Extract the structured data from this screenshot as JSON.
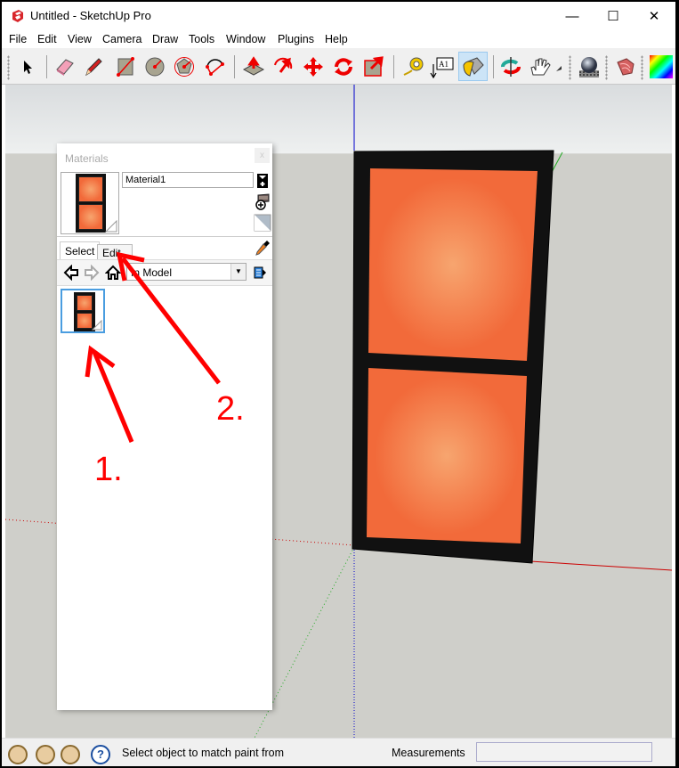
{
  "window": {
    "title": "Untitled - SketchUp Pro",
    "controls": {
      "minimize": "—",
      "maximize": "☐",
      "close": "✕"
    }
  },
  "menu": [
    "File",
    "Edit",
    "View",
    "Camera",
    "Draw",
    "Tools",
    "Window",
    "Plugins",
    "Help"
  ],
  "toolbar": {
    "tools": [
      {
        "name": "select-tool",
        "icon": "arrow-pointer"
      },
      {
        "name": "eraser-tool",
        "icon": "eraser"
      },
      {
        "name": "line-tool",
        "icon": "pencil"
      },
      {
        "name": "rectangle-tool",
        "icon": "rectangle"
      },
      {
        "name": "circle-tool",
        "icon": "circle"
      },
      {
        "name": "polygon-tool",
        "icon": "polygon"
      },
      {
        "name": "arc-tool",
        "icon": "arc"
      },
      {
        "name": "push-pull-tool",
        "icon": "push-pull"
      },
      {
        "name": "follow-me-tool",
        "icon": "follow-me"
      },
      {
        "name": "move-tool",
        "icon": "move"
      },
      {
        "name": "rotate-tool",
        "icon": "rotate"
      },
      {
        "name": "scale-tool",
        "icon": "scale"
      },
      {
        "name": "tape-measure-tool",
        "icon": "tape-measure"
      },
      {
        "name": "text-tool",
        "icon": "text",
        "label": "A1"
      },
      {
        "name": "paint-bucket-tool",
        "icon": "paint-bucket",
        "active": true
      },
      {
        "name": "orbit-tool",
        "icon": "orbit"
      },
      {
        "name": "pan-tool",
        "icon": "hand"
      },
      {
        "name": "render-tool",
        "icon": "sphere"
      },
      {
        "name": "sandbox-tool",
        "icon": "terrain"
      },
      {
        "name": "color-tool",
        "icon": "color-gradient"
      }
    ]
  },
  "materials_panel": {
    "title": "Materials",
    "close_label": "x",
    "material_name": "Material1",
    "tabs": [
      {
        "label": "Select",
        "selected": true
      },
      {
        "label": "Edit",
        "selected": false
      }
    ],
    "collection": "In Model",
    "swatch_colors": {
      "center": "#f7a56f",
      "edge": "#f26a3a",
      "frame": "#111111"
    }
  },
  "annotations": [
    {
      "label": "1.",
      "target": "material-thumbnail"
    },
    {
      "label": "2.",
      "target": "edit-tab"
    }
  ],
  "statusbar": {
    "hint": "Select object to match paint from",
    "measurements_label": "Measurements",
    "measurements_value": ""
  },
  "colors": {
    "annotation_red": "#ff0000",
    "axis_red": "#cc0000",
    "axis_green": "#22aa22",
    "axis_blue": "#0000cc",
    "selection_blue": "#4a9de0"
  }
}
